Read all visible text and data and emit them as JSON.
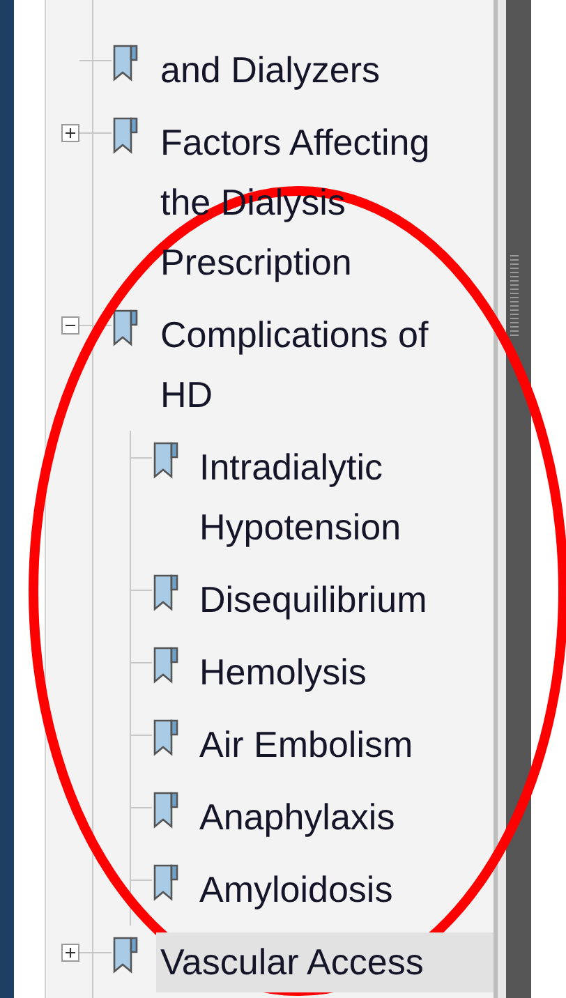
{
  "bookmarks": [
    {
      "label": "and Dialyzers",
      "selected": false
    },
    {
      "label": "Factors Affecting the Dialysis Prescription",
      "expanded": false,
      "selected": false
    },
    {
      "label": "Complications of HD",
      "expanded": true,
      "selected": false,
      "children": [
        {
          "label": "Intradialytic Hypotension",
          "selected": false
        },
        {
          "label": "Disequilibrium",
          "selected": false
        },
        {
          "label": "Hemolysis",
          "selected": false
        },
        {
          "label": "Air Embolism",
          "selected": false
        },
        {
          "label": "Anaphylaxis",
          "selected": false
        },
        {
          "label": "Amyloidosis",
          "selected": false
        }
      ]
    },
    {
      "label": "Vascular Access",
      "expanded": false,
      "selected": true
    }
  ]
}
